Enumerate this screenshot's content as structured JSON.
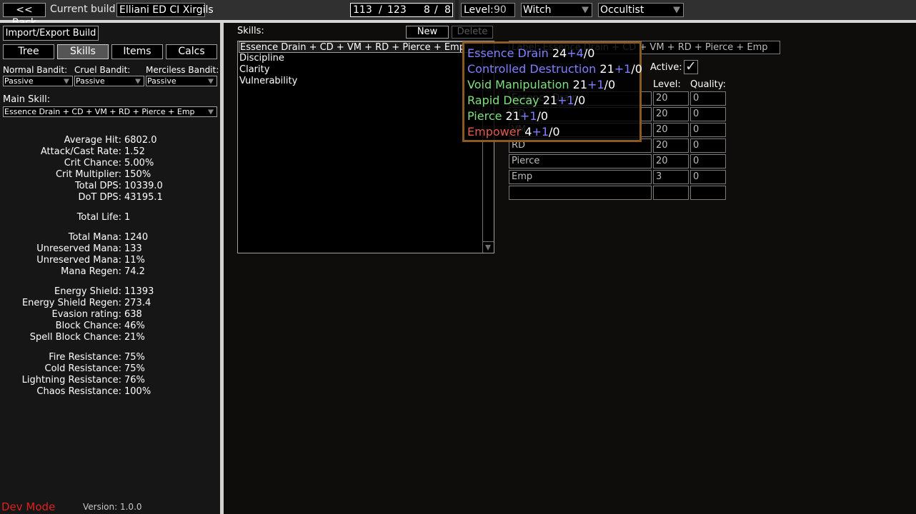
{
  "topbar": {
    "back_label": "<< Back",
    "current_build_label": "Current build:",
    "build_name": "Elliani ED CI Xirgils",
    "points_used": "113",
    "points_total": "123",
    "ascend_used": "8",
    "ascend_total": "8",
    "points_sep": "/",
    "level_label": "Level:",
    "level_value": "90",
    "class_value": "Witch",
    "ascendancy_value": "Occultist"
  },
  "left": {
    "import_export_label": "Import/Export Build",
    "tabs": [
      {
        "label": "Tree",
        "active": false
      },
      {
        "label": "Skills",
        "active": true
      },
      {
        "label": "Items",
        "active": false
      },
      {
        "label": "Calcs",
        "active": false
      }
    ],
    "bandits": {
      "normal_label": "Normal Bandit:",
      "cruel_label": "Cruel Bandit:",
      "merciless_label": "Merciless Bandit:",
      "normal_value": "Passive",
      "cruel_value": "Passive",
      "merciless_value": "Passive"
    },
    "main_skill_label": "Main Skill:",
    "main_skill_value": "Essence Drain + CD + VM + RD + Pierce + Emp",
    "stats": [
      {
        "label": "Average Hit:",
        "value": "6802.0"
      },
      {
        "label": "Attack/Cast Rate:",
        "value": "1.52"
      },
      {
        "label": "Crit Chance:",
        "value": "5.00%"
      },
      {
        "label": "Crit Multiplier:",
        "value": "150%"
      },
      {
        "label": "Total DPS:",
        "value": "10339.0"
      },
      {
        "label": "DoT DPS:",
        "value": "43195.1"
      },
      {
        "label": "Total Life:",
        "value": "1"
      },
      {
        "label": "Total Mana:",
        "value": "1240"
      },
      {
        "label": "Unreserved Mana:",
        "value": "133"
      },
      {
        "label": "Unreserved Mana:",
        "value": "11%"
      },
      {
        "label": "Mana Regen:",
        "value": "74.2"
      },
      {
        "label": "Energy Shield:",
        "value": "11393"
      },
      {
        "label": "Energy Shield Regen:",
        "value": "273.4"
      },
      {
        "label": "Evasion rating:",
        "value": "638"
      },
      {
        "label": "Block Chance:",
        "value": "46%"
      },
      {
        "label": "Spell Block Chance:",
        "value": "21%"
      },
      {
        "label": "Fire Resistance:",
        "value": "75%"
      },
      {
        "label": "Cold Resistance:",
        "value": "75%"
      },
      {
        "label": "Lightning Resistance:",
        "value": "76%"
      },
      {
        "label": "Chaos Resistance:",
        "value": "100%"
      }
    ],
    "dev_mode_label": "Dev Mode",
    "version_label": "Version: 1.0.0"
  },
  "skills": {
    "header_label": "Skills:",
    "new_label": "New",
    "delete_label": "Delete",
    "list": [
      "Essence Drain + CD + VM + RD + Pierce + Emp",
      "Discipline",
      "Clarity",
      "Vulnerability"
    ],
    "selected_index": 0
  },
  "group": {
    "label_field_value": "Label: Essence Drain + CD + VM + RD + Pierce + Emp",
    "active_label": "Active:",
    "active_checked": true,
    "check_glyph": "✓",
    "level_header": "Level:",
    "quality_header": "Quality:",
    "gems": [
      {
        "name": "Essence Drain",
        "level": "20",
        "quality": "0"
      },
      {
        "name": "CD",
        "level": "20",
        "quality": "0"
      },
      {
        "name": "VM",
        "level": "20",
        "quality": "0"
      },
      {
        "name": "RD",
        "level": "20",
        "quality": "0"
      },
      {
        "name": "Pierce",
        "level": "20",
        "quality": "0"
      },
      {
        "name": "Emp",
        "level": "3",
        "quality": "0"
      },
      {
        "name": "",
        "level": "",
        "quality": ""
      }
    ]
  },
  "tooltip": {
    "lines": [
      {
        "name": "Essence Drain",
        "color": "#8080ff",
        "base": "24",
        "plus": "+",
        "bonus": "4",
        "rest": "/0"
      },
      {
        "name": "Controlled Destruction",
        "color": "#8080ff",
        "base": "21",
        "plus": "+",
        "bonus": "1",
        "rest": "/0"
      },
      {
        "name": "Void Manipulation",
        "color": "#80e080",
        "base": "21",
        "plus": "+",
        "bonus": "1",
        "rest": "/0"
      },
      {
        "name": "Rapid Decay",
        "color": "#80e080",
        "base": "21",
        "plus": "+",
        "bonus": "1",
        "rest": "/0"
      },
      {
        "name": "Pierce",
        "color": "#80e080",
        "base": "21",
        "plus": "+",
        "bonus": "1",
        "rest": "/0"
      },
      {
        "name": "Empower",
        "color": "#e05a4a",
        "base": "4",
        "plus": "+",
        "bonus": "1",
        "rest": "/0"
      }
    ]
  },
  "colors": {
    "dev_mode": "#e02020",
    "tooltip_border": "#8a5a20",
    "gem_blue": "#8080ff",
    "gem_green": "#80e080",
    "gem_red": "#e05a4a"
  }
}
